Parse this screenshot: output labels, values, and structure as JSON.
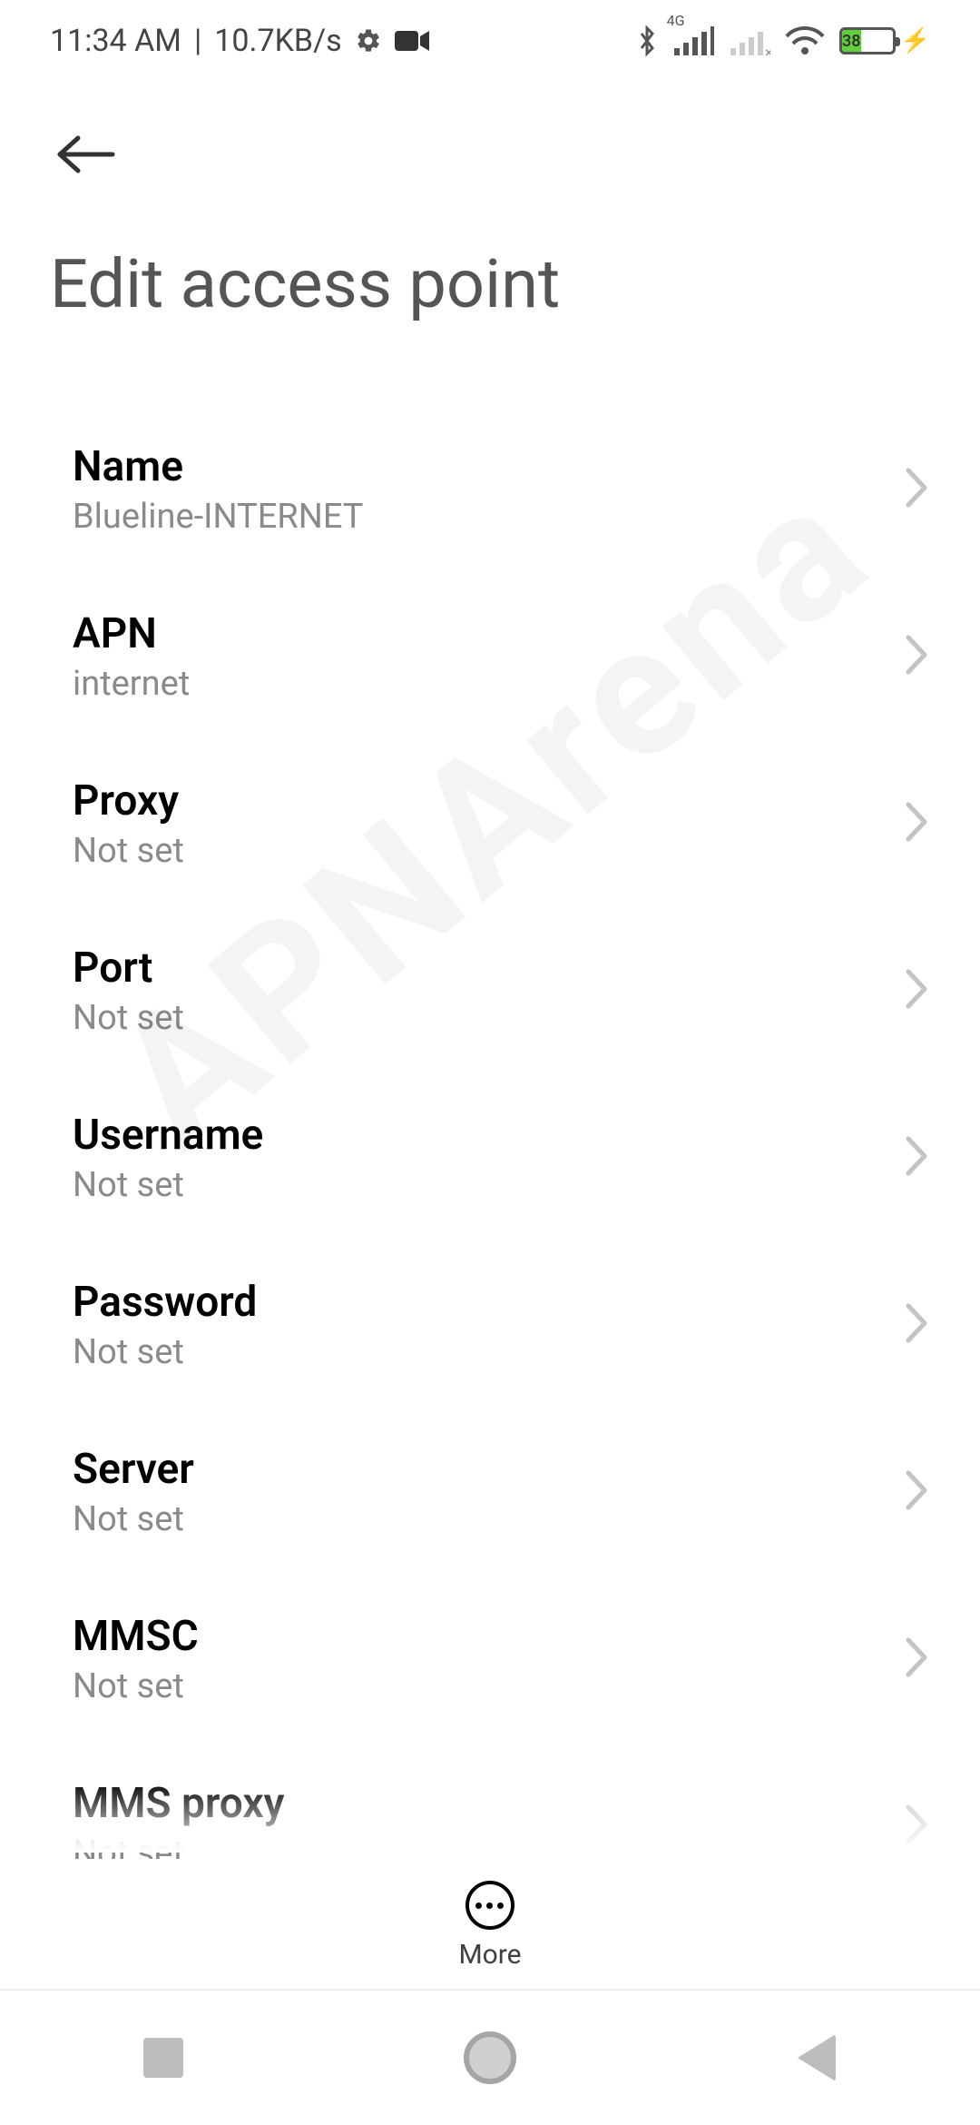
{
  "statusBar": {
    "time": "11:34 AM",
    "separator": " | ",
    "speed": "10.7KB/s",
    "batteryPercent": "38",
    "networkLabel": "4G"
  },
  "page": {
    "title": "Edit access point"
  },
  "items": [
    {
      "title": "Name",
      "sub": "Blueline-INTERNET"
    },
    {
      "title": "APN",
      "sub": "internet"
    },
    {
      "title": "Proxy",
      "sub": "Not set"
    },
    {
      "title": "Port",
      "sub": "Not set"
    },
    {
      "title": "Username",
      "sub": "Not set"
    },
    {
      "title": "Password",
      "sub": "Not set"
    },
    {
      "title": "Server",
      "sub": "Not set"
    },
    {
      "title": "MMSC",
      "sub": "Not set"
    },
    {
      "title": "MMS proxy",
      "sub": "Not set"
    }
  ],
  "bottom": {
    "moreLabel": "More"
  },
  "watermark": "APNArena"
}
